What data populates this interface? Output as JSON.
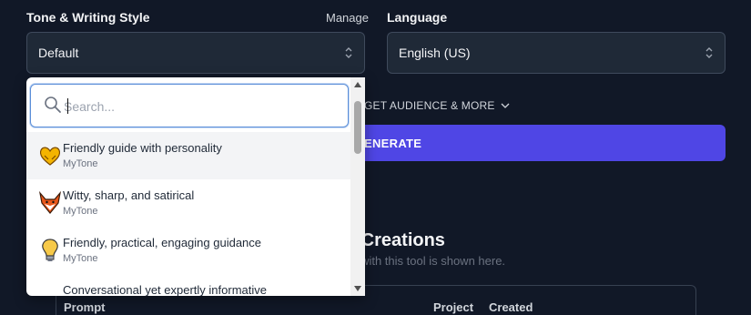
{
  "tone": {
    "label": "Tone & Writing Style",
    "manage_label": "Manage",
    "selected": "Default"
  },
  "language": {
    "label": "Language",
    "selected": "English (US)"
  },
  "audience_toggle": "GET AUDIENCE & MORE",
  "generate_label": "ENERATE",
  "creations": {
    "title": "s Creations",
    "subtitle": "ed with this tool is shown here.",
    "columns": [
      "Prompt",
      "Project",
      "Created"
    ]
  },
  "dropdown": {
    "search_placeholder": "Search...",
    "options": [
      {
        "title": "Friendly guide with personality",
        "source": "MyTone",
        "icon": "heart-hands-icon"
      },
      {
        "title": "Witty, sharp, and satirical",
        "source": "MyTone",
        "icon": "fox-icon"
      },
      {
        "title": "Friendly, practical, engaging guidance",
        "source": "MyTone",
        "icon": "lightbulb-icon"
      },
      {
        "title": "Conversational yet expertly informative",
        "source": "",
        "icon": "book-icon"
      }
    ]
  },
  "colors": {
    "background": "#111827",
    "accent": "#4f46e5",
    "field_bg": "#1f2937"
  }
}
